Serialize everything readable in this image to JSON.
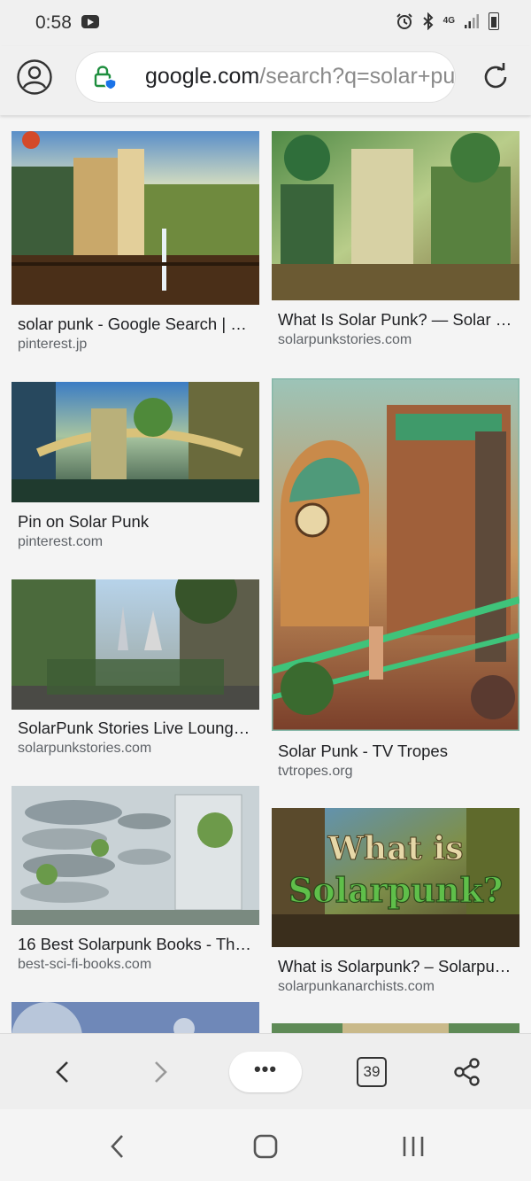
{
  "status": {
    "time": "0:58",
    "network": "4G"
  },
  "address_bar": {
    "url_host": "google.com",
    "url_path": "/search?q=solar+punk"
  },
  "results": [
    {
      "title": "solar punk - Google Search | …",
      "site": "pinterest.jp",
      "image": "steampunk city with tower and balloon"
    },
    {
      "title": "What Is Solar Punk? — Solar P…",
      "site": "solarpunkstories.com",
      "image": "green overgrown city"
    },
    {
      "title": "Pin on Solar Punk",
      "site": "pinterest.com",
      "image": "city with bridges and plants"
    },
    {
      "title": "Solar Punk - TV Tropes",
      "site": "tvtropes.org",
      "image": "domed building with green railings"
    },
    {
      "title": "SolarPunk Stories Live Loung…",
      "site": "solarpunkstories.com",
      "image": "street with green walls and spires"
    },
    {
      "title": "16 Best Solarpunk Books - Th…",
      "site": "best-sci-fi-books.com",
      "image": "spiral green towers"
    },
    {
      "title": "What is Solarpunk? – Solarpu…",
      "site": "solarpunkanarchists.com",
      "image": "What is Solarpunk? banner",
      "overlay_text": "What is Solarpunk?"
    }
  ],
  "toolbar": {
    "more_label": "•••",
    "tab_count": "39"
  },
  "colors": {
    "background": "#f4f4f4",
    "bar": "#eeeeee",
    "lock_green": "#1e8e3e",
    "lock_blue": "#1a73e8"
  }
}
